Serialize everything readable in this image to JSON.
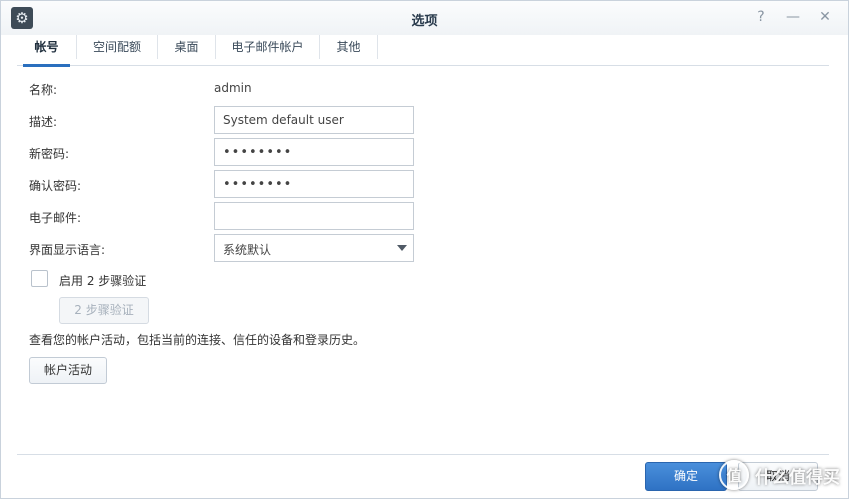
{
  "window": {
    "title": "选项"
  },
  "controls": {
    "help": "?",
    "minimize": "—",
    "close": "✕"
  },
  "tabs": [
    {
      "label": "帐号"
    },
    {
      "label": "空间配额"
    },
    {
      "label": "桌面"
    },
    {
      "label": "电子邮件帐户"
    },
    {
      "label": "其他"
    }
  ],
  "form": {
    "name_label": "名称:",
    "name_value": "admin",
    "desc_label": "描述:",
    "desc_value": "System default user",
    "new_pw_label": "新密码:",
    "new_pw_value": "••••••••",
    "confirm_pw_label": "确认密码:",
    "confirm_pw_value": "••••••••",
    "email_label": "电子邮件:",
    "email_value": "",
    "lang_label": "界面显示语言:",
    "lang_value": "系统默认",
    "two_step_checkbox_label": "启用 2 步骤验证",
    "two_step_button": "2 步骤验证",
    "activity_desc": "查看您的帐户活动，包括当前的连接、信任的设备和登录历史。",
    "activity_button": "帐户活动"
  },
  "footer": {
    "ok_button": "确定",
    "cancel_button": "取消"
  },
  "watermark": {
    "text": "什么值得买",
    "logo": "值"
  },
  "colors": {
    "accent": "#2a6fbe",
    "primary_button": "#3a7fd0"
  }
}
